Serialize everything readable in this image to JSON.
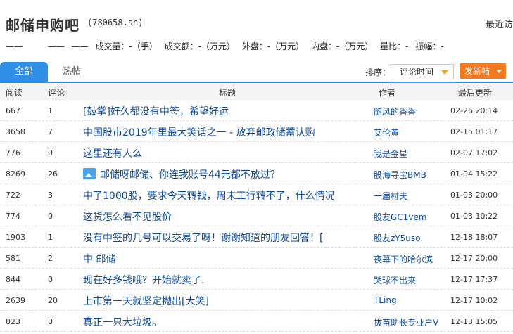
{
  "header": {
    "title": "邮储申购吧",
    "code": "(780658.sh)",
    "recent": "最近访"
  },
  "stats": {
    "price": "——",
    "change": "——",
    "change_pct": "——",
    "volume": "成交量：-（手）",
    "amount": "成交额：-（万元）",
    "outer": "外盘：-（万元）",
    "inner": "内盘：-（万元）",
    "ratio": "量比：-",
    "amplitude": "振幅：-"
  },
  "tabs": {
    "all": "全部",
    "hot": "热帖"
  },
  "sort": {
    "label": "排序：",
    "selected": "评论时间",
    "post_button": "发新帖"
  },
  "columns": {
    "read": "阅读",
    "comments": "评论",
    "title": "标题",
    "author": "作者",
    "updated": "最后更新"
  },
  "posts": [
    {
      "read": "667",
      "comments": "1",
      "title": "[鼓掌]好久都没有中签，希望好运",
      "author": "随风的香香",
      "time": "02-26 20:14",
      "image": false
    },
    {
      "read": "3658",
      "comments": "7",
      "title": "中国股市2019年里最大笑话之一 - 放弃邮政储蓄认购",
      "author": "艾伦黄",
      "time": "02-15 01:17",
      "image": false
    },
    {
      "read": "776",
      "comments": "0",
      "title": "这里还有人么",
      "author": "我是金星",
      "time": "02-07 17:02",
      "image": false
    },
    {
      "read": "8269",
      "comments": "26",
      "title": "邮储呀邮储、你连我账号44元都不放过？",
      "author": "股海寻宝BMB",
      "time": "01-04 15:22",
      "image": true
    },
    {
      "read": "722",
      "comments": "3",
      "title": "中了1000股，要求今天转钱，周末工行转不了，什么情况",
      "author": "一届村夫",
      "time": "01-03 20:00",
      "image": false
    },
    {
      "read": "774",
      "comments": "0",
      "title": "这货怎么看不见股价",
      "author": "股友GC1vem",
      "time": "01-03 10:22",
      "image": false
    },
    {
      "read": "1903",
      "comments": "1",
      "title": "没有中签的几号可以交易了呀！谢谢知道的朋友回答！[",
      "author": "股友zY5uso",
      "time": "12-18 18:07",
      "image": false
    },
    {
      "read": "581",
      "comments": "2",
      "title": "中 邮储",
      "author": "夜幕下的哈尔滨",
      "time": "12-17 20:00",
      "image": false
    },
    {
      "read": "844",
      "comments": "0",
      "title": "现在好多钱哦？开始就卖了.",
      "author": "哭球不出来",
      "time": "12-17 17:37",
      "image": false
    },
    {
      "read": "2639",
      "comments": "20",
      "title": "上市第一天就坚定抛出[大笑]",
      "author": "TLing",
      "time": "12-17 10:02",
      "image": false
    },
    {
      "read": "823",
      "comments": "0",
      "title": "真正一只大垃圾。",
      "author": "拔苗助长专业户V",
      "time": "12-13 15:05",
      "image": false
    }
  ],
  "colors": {
    "accent": "#2f8ee6",
    "post_button": "#f47920",
    "link": "#0e4b9e"
  }
}
